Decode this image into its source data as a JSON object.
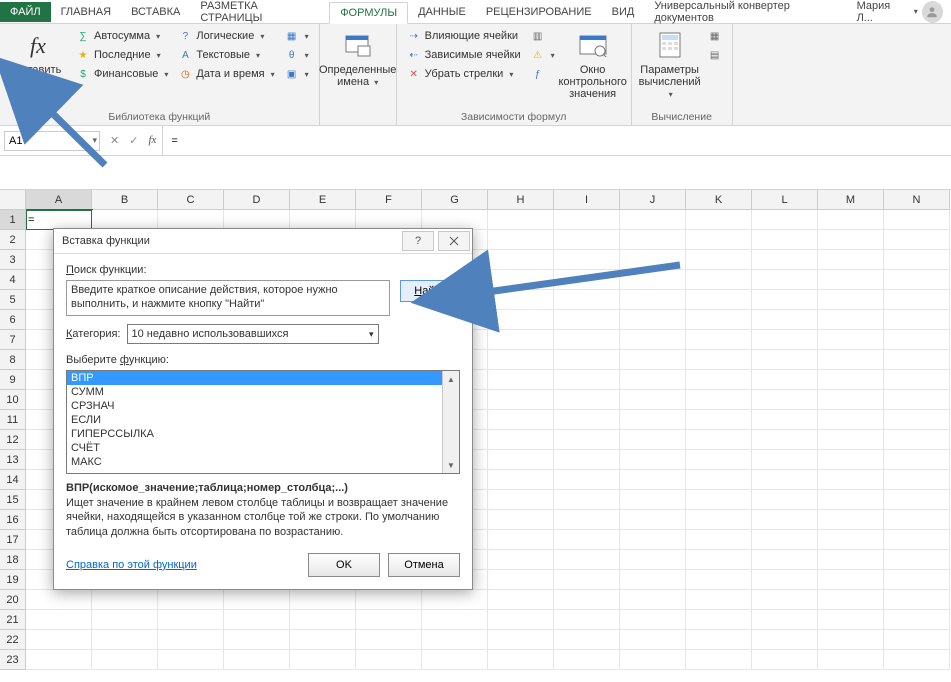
{
  "tabs": {
    "file": "ФАЙЛ",
    "home": "ГЛАВНАЯ",
    "insert": "ВСТАВКА",
    "layout": "РАЗМЕТКА СТРАНИЦЫ",
    "formulas": "ФОРМУЛЫ",
    "data": "ДАННЫЕ",
    "review": "РЕЦЕНЗИРОВАНИЕ",
    "view": "ВИД",
    "converter": "Универсальный конвертер документов",
    "user": "Мария Л..."
  },
  "ribbon": {
    "insert_fn": {
      "line1": "Вставить",
      "line2": "функцию"
    },
    "lib": {
      "autosum": "Автосумма",
      "recent": "Последние",
      "financial": "Финансовые",
      "logical": "Логические",
      "text": "Текстовые",
      "datetime": "Дата и время",
      "group_title": "Библиотека функций"
    },
    "names": {
      "label": "Определенные",
      "label2": "имена",
      "group_title": ""
    },
    "deps": {
      "precedents": "Влияющие ячейки",
      "dependents": "Зависимые ячейки",
      "remove_arrows": "Убрать стрелки",
      "watch_window1": "Окно контрольного",
      "watch_window2": "значения",
      "group_title": "Зависимости формул"
    },
    "calc": {
      "options1": "Параметры",
      "options2": "вычислений",
      "group_title": "Вычисление"
    }
  },
  "formula_bar": {
    "name_box": "A1",
    "formula": "="
  },
  "grid": {
    "cols": [
      "A",
      "B",
      "C",
      "D",
      "E",
      "F",
      "G",
      "H",
      "I",
      "J",
      "K",
      "L",
      "M",
      "N"
    ],
    "rows": 23,
    "a1": "="
  },
  "dialog": {
    "title": "Вставка функции",
    "search_label": "Поиск функции:",
    "search_text": "Введите краткое описание действия, которое нужно выполнить, и нажмите кнопку \"Найти\"",
    "find": "Найти",
    "category_label": "Категория:",
    "category_value": "10 недавно использовавшихся",
    "choose_label": "Выберите функцию:",
    "functions": [
      "ВПР",
      "СУММ",
      "СРЗНАЧ",
      "ЕСЛИ",
      "ГИПЕРССЫЛКА",
      "СЧЁТ",
      "МАКС"
    ],
    "signature": "ВПР(искомое_значение;таблица;номер_столбца;...)",
    "description": "Ищет значение в крайнем левом столбце таблицы и возвращает значение ячейки, находящейся в указанном столбце той же строки. По умолчанию таблица должна быть отсортирована по возрастанию.",
    "help_link": "Справка по этой функции",
    "ok": "OK",
    "cancel": "Отмена"
  },
  "underline": {
    "search_first": "П",
    "category_first": "К",
    "choose_mid": "ф",
    "find_first": "Н"
  }
}
